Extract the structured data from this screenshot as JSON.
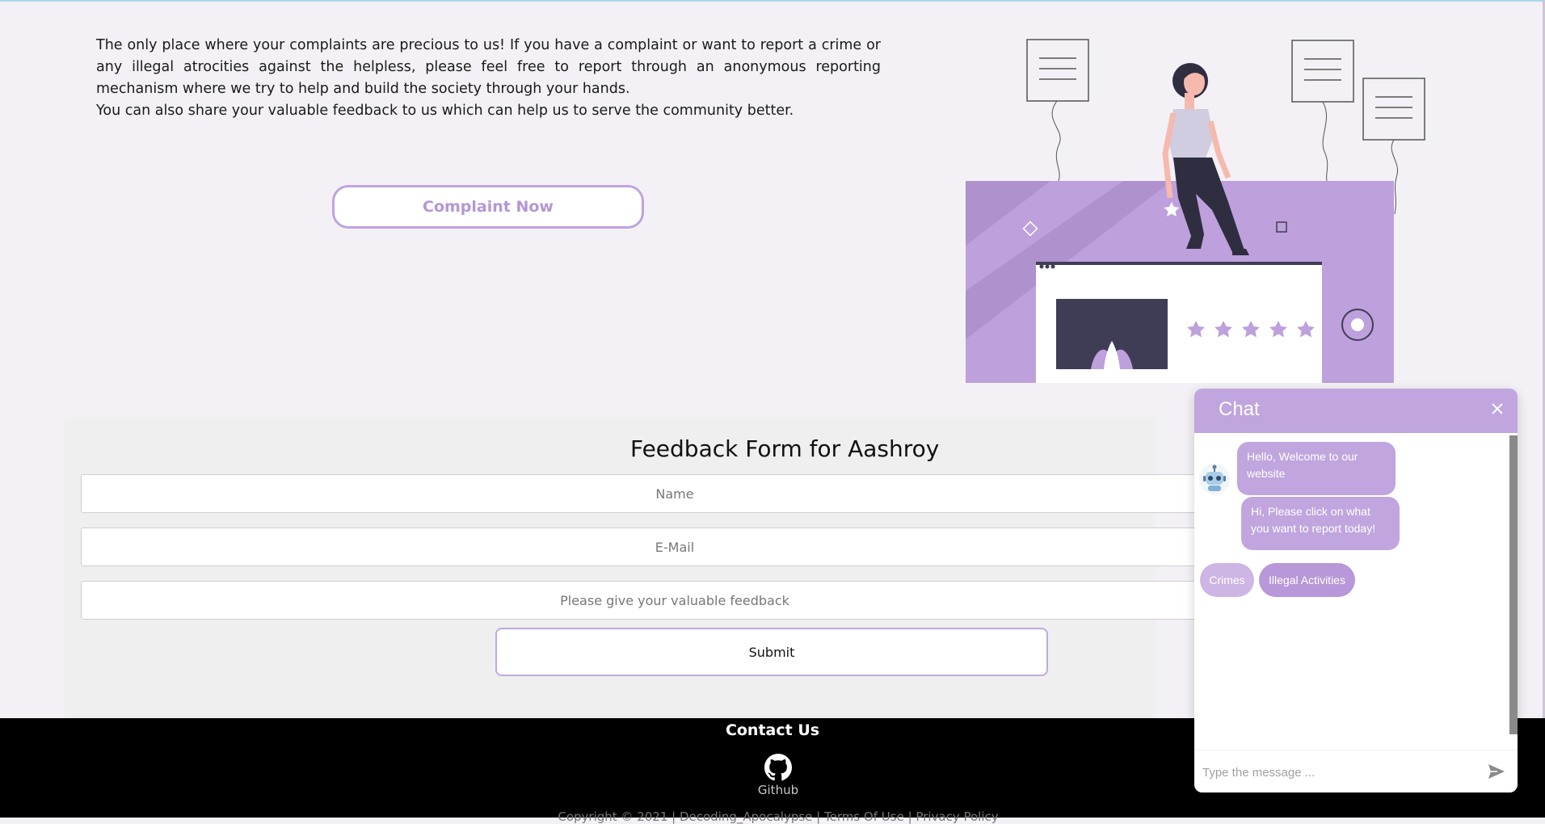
{
  "intro": {
    "paragraph1": "The only place where your complaints are precious to us! If you have a complaint or want to report a crime or any illegal atrocities against the helpless, please feel free to report through an anonymous reporting mechanism where we try to help and build the society through your hands.",
    "paragraph2": "You can also share your valuable feedback to us which can help us to serve the community better."
  },
  "complaint_button": "Complaint Now",
  "feedback_form": {
    "title": "Feedback Form for Aashroy",
    "name_placeholder": "Name",
    "email_placeholder": "E-Mail",
    "feedback_placeholder": "Please give your valuable feedback",
    "submit_label": "Submit"
  },
  "footer": {
    "contact_title": "Contact Us",
    "github_label": "Github",
    "copyright": "Copyright © 2021 | Decoding_Apocalypse | Terms Of Use | Privacy Policy"
  },
  "chat": {
    "title": "Chat",
    "messages": [
      "Hello, Welcome to our website",
      "Hi, Please click on what you want to report today!"
    ],
    "options": [
      "Crimes",
      "Illegal Activities"
    ],
    "input_placeholder": "Type the message ..."
  },
  "colors": {
    "accent": "#c0a5de",
    "illustration_purple": "#bea0dc",
    "footer_bg": "#000000"
  },
  "icons": [
    "github-icon",
    "close-icon",
    "send-icon",
    "robot-icon",
    "star-icon"
  ]
}
